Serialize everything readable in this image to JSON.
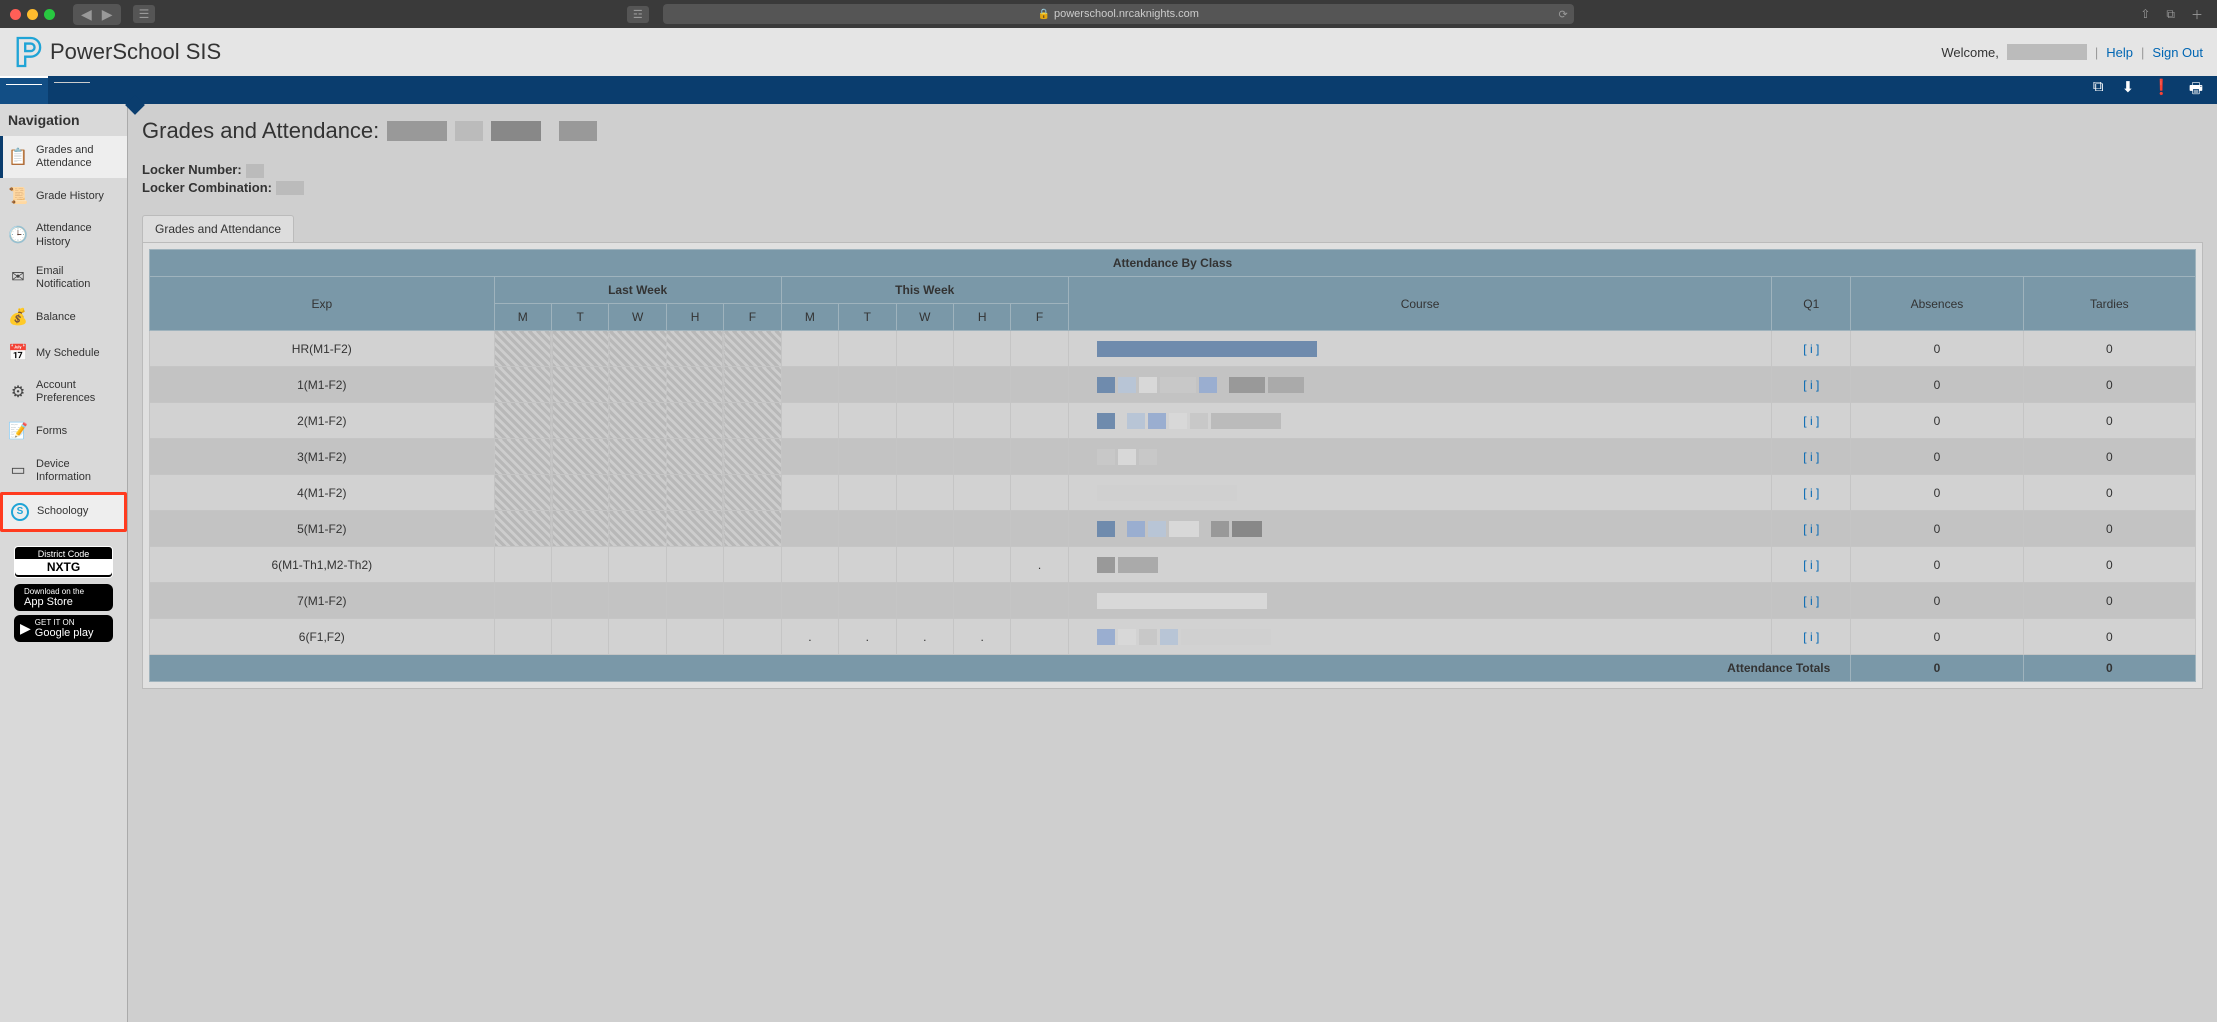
{
  "browser": {
    "url": "powerschool.nrcaknights.com"
  },
  "header": {
    "product": "PowerSchool SIS",
    "welcome": "Welcome,",
    "help": "Help",
    "signout": "Sign Out"
  },
  "sidebar": {
    "title": "Navigation",
    "items": [
      {
        "label": "Grades and Attendance",
        "icon": "grades-attendance-icon",
        "active": true
      },
      {
        "label": "Grade History",
        "icon": "grade-history-icon"
      },
      {
        "label": "Attendance History",
        "icon": "attendance-history-icon"
      },
      {
        "label": "Email Notification",
        "icon": "email-notification-icon"
      },
      {
        "label": "Balance",
        "icon": "balance-icon"
      },
      {
        "label": "My Schedule",
        "icon": "my-schedule-icon"
      },
      {
        "label": "Account Preferences",
        "icon": "account-preferences-icon"
      },
      {
        "label": "Forms",
        "icon": "forms-icon"
      },
      {
        "label": "Device Information",
        "icon": "device-information-icon"
      },
      {
        "label": "Schoology",
        "icon": "schoology-icon",
        "highlighted": true
      }
    ],
    "district_code_label": "District Code",
    "district_code": "NXTG",
    "appstore_small": "Download on the",
    "appstore_big": "App Store",
    "playstore_small": "GET IT ON",
    "playstore_big": "Google play"
  },
  "content": {
    "page_title_prefix": "Grades and Attendance:",
    "locker_number_label": "Locker Number:",
    "locker_combo_label": "Locker Combination:",
    "tab_label": "Grades and Attendance",
    "table_title": "Attendance By Class",
    "headers": {
      "exp": "Exp",
      "last_week": "Last Week",
      "this_week": "This Week",
      "course": "Course",
      "q1": "Q1",
      "absences": "Absences",
      "tardies": "Tardies",
      "days": [
        "M",
        "T",
        "W",
        "H",
        "F"
      ]
    },
    "q1_link": "[ i ]",
    "rows": [
      {
        "exp": "HR(M1-F2)",
        "absences": "0",
        "tardies": "0",
        "hatched": true
      },
      {
        "exp": "1(M1-F2)",
        "absences": "0",
        "tardies": "0",
        "hatched": true
      },
      {
        "exp": "2(M1-F2)",
        "absences": "0",
        "tardies": "0",
        "hatched": true
      },
      {
        "exp": "3(M1-F2)",
        "absences": "0",
        "tardies": "0",
        "hatched": true
      },
      {
        "exp": "4(M1-F2)",
        "absences": "0",
        "tardies": "0",
        "hatched": true
      },
      {
        "exp": "5(M1-F2)",
        "absences": "0",
        "tardies": "0",
        "hatched": true
      },
      {
        "exp": "6(M1-Th1,M2-Th2)",
        "absences": "0",
        "tardies": "0",
        "hatched": false,
        "this_week_marks": {
          "F": "."
        }
      },
      {
        "exp": "7(M1-F2)",
        "absences": "0",
        "tardies": "0",
        "hatched": false
      },
      {
        "exp": "6(F1,F2)",
        "absences": "0",
        "tardies": "0",
        "hatched": false,
        "this_week_marks": {
          "M": ".",
          "T": ".",
          "W": ".",
          "H": "."
        }
      }
    ],
    "totals": {
      "label": "Attendance Totals",
      "absences": "0",
      "tardies": "0"
    }
  }
}
